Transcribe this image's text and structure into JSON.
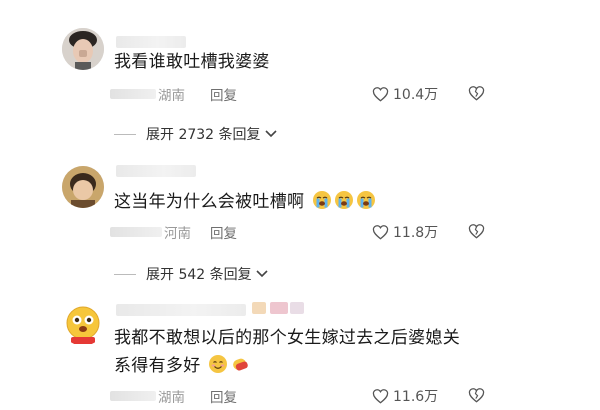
{
  "comments": [
    {
      "text": "我看谁敢吐槽我婆婆",
      "location": "湖南",
      "reply_label": "回复",
      "likes": "10.4万",
      "expand_label": "展开 2732 条回复"
    },
    {
      "text": "这当年为什么会被吐槽啊",
      "location": "河南",
      "reply_label": "回复",
      "likes": "11.8万",
      "expand_label": "展开 542 条回复"
    },
    {
      "text_line1": "我都不敢想以后的那个女生嫁过去之后婆媳关",
      "text_line2": "系得有多好",
      "location": "湖南",
      "reply_label": "回复",
      "likes": "11.6万"
    }
  ],
  "icons": {
    "like": "heart-outline-icon",
    "dislike": "broken-heart-outline-icon",
    "expand_chevron": "chevron-down-icon",
    "emoji_crying": "loudly-crying-face-emoji",
    "emoji_smile": "smiling-face-emoji",
    "emoji_hands": "hands-emoji"
  },
  "colors": {
    "text": "#1a1a1a",
    "meta": "#8a8a8a",
    "emoji_yellow": "#f5c542"
  }
}
